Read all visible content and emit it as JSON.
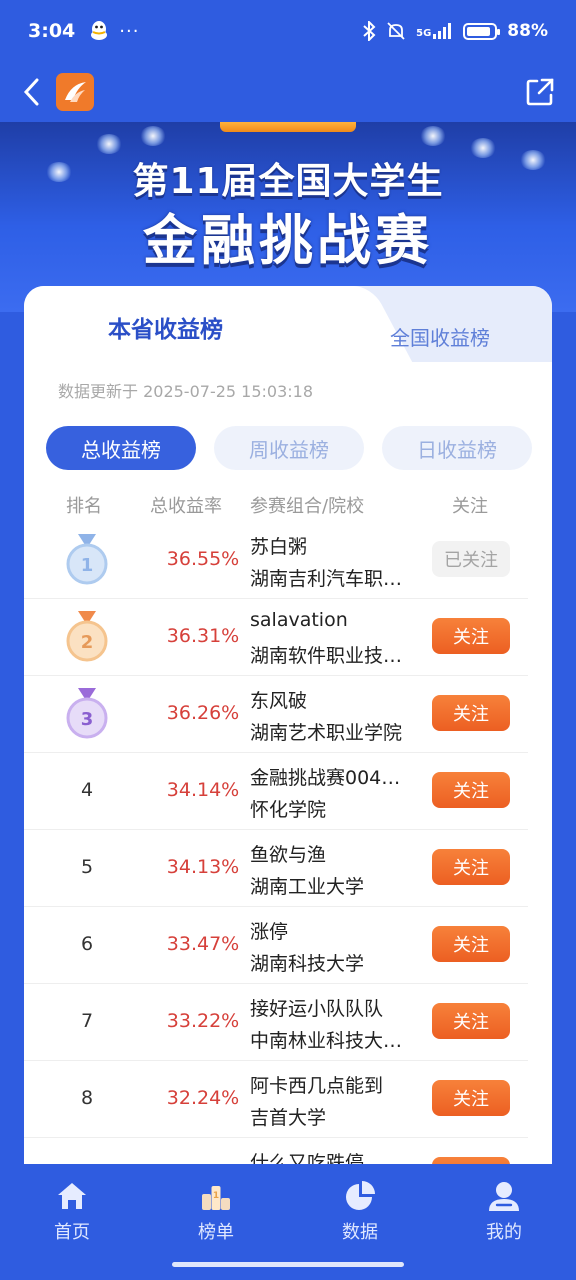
{
  "status_bar": {
    "time": "3:04",
    "dots": "···",
    "signal": "5G",
    "battery_level": 0.88,
    "battery_text": "88%"
  },
  "banner": {
    "title_line1": "第11届全国大学生",
    "title_line2": "金融挑战赛"
  },
  "tabs": {
    "local": "本省收益榜",
    "national": "全国收益榜"
  },
  "update_time": "数据更新于 2025-07-25 15:03:18",
  "sub_tabs": [
    "总收益榜",
    "周收益榜",
    "日收益榜"
  ],
  "table": {
    "headers": {
      "rank": "排名",
      "rate": "总收益率",
      "team": "参赛组合/院校",
      "follow": "关注"
    },
    "rows": [
      {
        "rank": "1",
        "rate": "36.55%",
        "name": "苏白粥",
        "school": "湖南吉利汽车职…",
        "follow": "已关注",
        "followed": true,
        "medal": "silver"
      },
      {
        "rank": "2",
        "rate": "36.31%",
        "name": "salavation",
        "school": "湖南软件职业技…",
        "follow": "关注",
        "followed": false,
        "medal": "bronze"
      },
      {
        "rank": "3",
        "rate": "36.26%",
        "name": "东风破",
        "school": "湖南艺术职业学院",
        "follow": "关注",
        "followed": false,
        "medal": "purple"
      },
      {
        "rank": "4",
        "rate": "34.14%",
        "name": "金融挑战赛004…",
        "school": "怀化学院",
        "follow": "关注",
        "followed": false
      },
      {
        "rank": "5",
        "rate": "34.13%",
        "name": "鱼欲与渔",
        "school": "湖南工业大学",
        "follow": "关注",
        "followed": false
      },
      {
        "rank": "6",
        "rate": "33.47%",
        "name": "涨停",
        "school": "湖南科技大学",
        "follow": "关注",
        "followed": false
      },
      {
        "rank": "7",
        "rate": "33.22%",
        "name": "接好运小队队队",
        "school": "中南林业科技大…",
        "follow": "关注",
        "followed": false
      },
      {
        "rank": "8",
        "rate": "32.24%",
        "name": "阿卡西几点能到",
        "school": "吉首大学",
        "follow": "关注",
        "followed": false
      },
      {
        "rank": "",
        "rate": "",
        "name": "什么又吃跌停",
        "school": "",
        "follow": "关注",
        "followed": false
      }
    ]
  },
  "bottom_nav": [
    "首页",
    "榜单",
    "数据",
    "我的"
  ],
  "colors": {
    "brand_blue": "#2f5ce0",
    "accent_orange": "#ec5f22",
    "rate_red": "#d6403a"
  }
}
